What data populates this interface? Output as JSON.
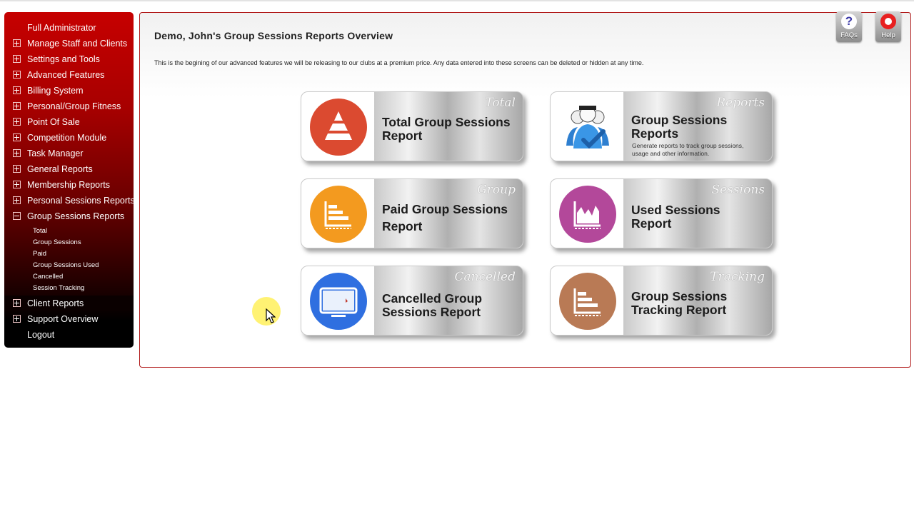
{
  "sidebar": {
    "top_item": "Full Administrator",
    "items": [
      {
        "label": "Manage Staff and Clients",
        "toggle": "plus"
      },
      {
        "label": "Settings and Tools",
        "toggle": "plus"
      },
      {
        "label": "Advanced Features",
        "toggle": "plus"
      },
      {
        "label": "Billing System",
        "toggle": "plus"
      },
      {
        "label": "Personal/Group Fitness",
        "toggle": "plus"
      },
      {
        "label": "Point Of Sale",
        "toggle": "plus"
      },
      {
        "label": "Competition Module",
        "toggle": "plus"
      },
      {
        "label": "Task Manager",
        "toggle": "plus"
      },
      {
        "label": "General Reports",
        "toggle": "plus"
      },
      {
        "label": "Membership Reports",
        "toggle": "plus"
      },
      {
        "label": "Personal Sessions Reports",
        "toggle": "plus"
      },
      {
        "label": "Group Sessions Reports",
        "toggle": "minus"
      }
    ],
    "sub_items": [
      "Total",
      "Group Sessions",
      "Paid",
      "Group Sessions Used",
      "Cancelled",
      "Session Tracking"
    ],
    "after_items": [
      {
        "label": "Client Reports",
        "toggle": "plus"
      },
      {
        "label": "Support Overview",
        "toggle": "plus"
      }
    ],
    "logout": "Logout"
  },
  "main": {
    "title": "Demo, John's Group Sessions Reports Overview",
    "intro": "This is the begining of our advanced features we will be releasing to our clubs at a premium price. Any data entered into these screens can be deleted or hidden at any time."
  },
  "help_buttons": {
    "faqs": "FAQs",
    "faqs_glyph": "?",
    "help": "Help"
  },
  "tiles": [
    {
      "title_l1": "Total Group Sessions",
      "title_l2": "Report",
      "script": "Total",
      "icon": "pyramid-icon",
      "color": "#db4a30"
    },
    {
      "title_l1": "Group Sessions",
      "title_l2": "Reports",
      "script": "Reports",
      "icon": "users-check-icon",
      "color": "#3a8fd8",
      "desc": "Generate reports to track group sessions, usage and other information."
    },
    {
      "title_l1": "Paid Group Sessions",
      "title_l2": "Report",
      "script": "Group",
      "icon": "bar-chart-icon",
      "color": "#f39a1f"
    },
    {
      "title_l1": "Used Sessions",
      "title_l2": "Report",
      "script": "Sessions",
      "icon": "area-chart-icon",
      "color": "#b3489a"
    },
    {
      "title_l1": "Cancelled Group",
      "title_l2": "Sessions Report",
      "script": "Cancelled",
      "icon": "monitor-icon",
      "color": "#2f6fe0"
    },
    {
      "title_l1": "Group Sessions",
      "title_l2": "Tracking Report",
      "script": "Tracking",
      "icon": "bar-chart-icon",
      "color": "#b97a55"
    }
  ]
}
